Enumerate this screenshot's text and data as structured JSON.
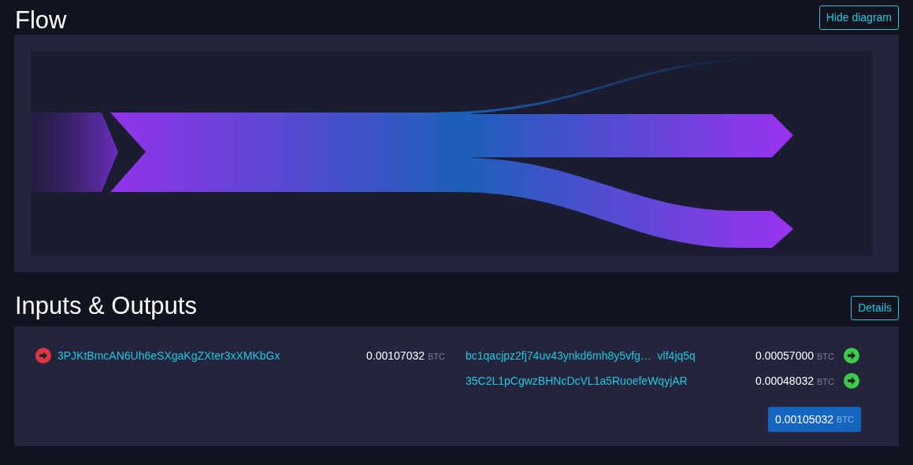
{
  "flow": {
    "title": "Flow",
    "hide_button": "Hide diagram"
  },
  "io": {
    "title": "Inputs & Outputs",
    "details_button": "Details",
    "inputs": [
      {
        "address": "3PJKtBmcAN6Uh6eSXgaKgZXter3xXMKbGx",
        "amount": "0.00107032",
        "unit": "BTC"
      }
    ],
    "outputs": [
      {
        "address": "bc1qacjpz2fj74uv43ynkd6mh8y5vfg…  vlf4jq5q",
        "amount": "0.00057000",
        "unit": "BTC"
      },
      {
        "address": "35C2L1pCgwzBHNcDcVL1a5RuoefeWqyjAR",
        "amount": "0.00048032",
        "unit": "BTC"
      }
    ],
    "total": {
      "amount": "0.00105032",
      "unit": "BTC"
    }
  }
}
